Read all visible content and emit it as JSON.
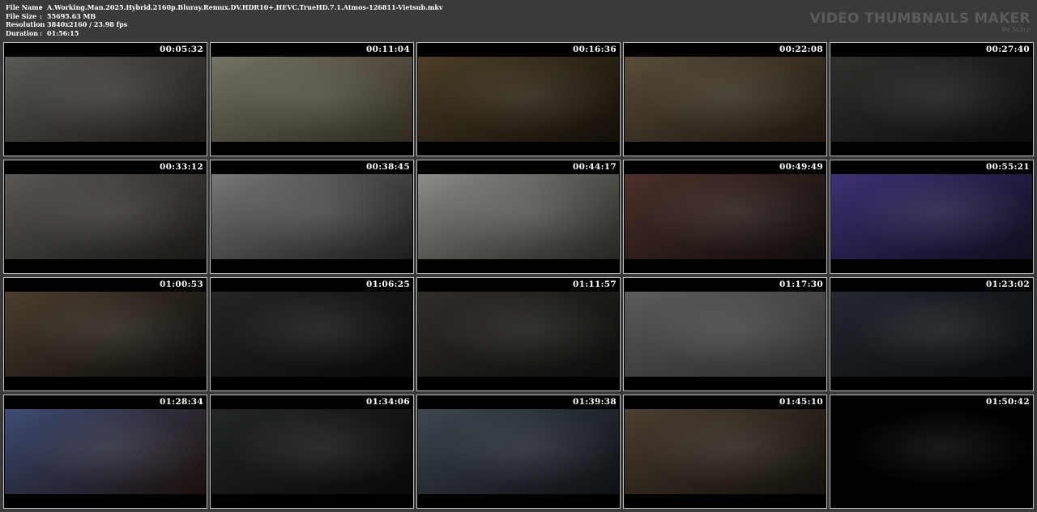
{
  "info": [
    {
      "key": "File Name",
      "value": "A.Working.Man.2025.Hybrid.2160p.Bluray.Remux.DV.HDR10+.HEVC.TrueHD.7.1.Atmos-126811-Vietsub.mkv"
    },
    {
      "key": "File Size",
      "value": "55695.63 MB"
    },
    {
      "key": "Resolution",
      "value": "3840x2160 / 23.98 fps"
    },
    {
      "key": "Duration",
      "value": "01:56:15"
    }
  ],
  "separator": ":",
  "brand": {
    "title": "VIDEO THUMBNAILS MAKER",
    "sub": "by Scorp"
  },
  "thumbnails": [
    {
      "time": "00:05:32",
      "tone": [
        "#6b6a66",
        "#2c2620"
      ]
    },
    {
      "time": "00:11:04",
      "tone": [
        "#8b8778",
        "#4a4232"
      ]
    },
    {
      "time": "00:16:36",
      "tone": [
        "#5a4a2e",
        "#1e170d"
      ]
    },
    {
      "time": "00:22:08",
      "tone": [
        "#6a5b45",
        "#2d2418"
      ]
    },
    {
      "time": "00:27:40",
      "tone": [
        "#3b3936",
        "#121111"
      ]
    },
    {
      "time": "00:33:12",
      "tone": [
        "#6b6862",
        "#2a2724"
      ]
    },
    {
      "time": "00:38:45",
      "tone": [
        "#8d8f8c",
        "#2f302d"
      ]
    },
    {
      "time": "00:44:17",
      "tone": [
        "#a6a7a2",
        "#3e3b35"
      ]
    },
    {
      "time": "00:49:49",
      "tone": [
        "#5a3a32",
        "#1a1414"
      ]
    },
    {
      "time": "00:55:21",
      "tone": [
        "#4a3a8a",
        "#1a1430"
      ]
    },
    {
      "time": "01:00:53",
      "tone": [
        "#5a4a38",
        "#141210"
      ]
    },
    {
      "time": "01:06:25",
      "tone": [
        "#2a2c2e",
        "#0e0f10"
      ]
    },
    {
      "time": "01:11:57",
      "tone": [
        "#3a3630",
        "#151412"
      ]
    },
    {
      "time": "01:17:30",
      "tone": [
        "#6e6c6a",
        "#4a4846"
      ]
    },
    {
      "time": "01:23:02",
      "tone": [
        "#2a3038",
        "#0e1116"
      ]
    },
    {
      "time": "01:28:34",
      "tone": [
        "#4a5a8a",
        "#2a1a14"
      ]
    },
    {
      "time": "01:34:06",
      "tone": [
        "#2a2e2a",
        "#0d0f0d"
      ]
    },
    {
      "time": "01:39:38",
      "tone": [
        "#4a5460",
        "#151a20"
      ]
    },
    {
      "time": "01:45:10",
      "tone": [
        "#5a4a3a",
        "#1e1812"
      ]
    },
    {
      "time": "01:50:42",
      "tone": [
        "#000000",
        "#000000"
      ]
    }
  ]
}
